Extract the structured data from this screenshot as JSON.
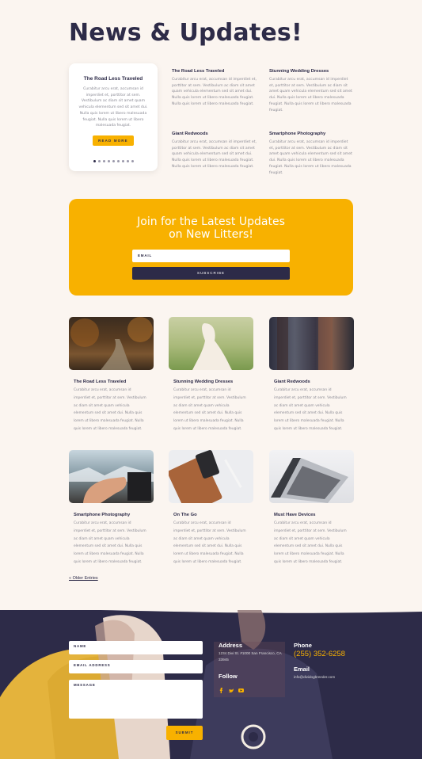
{
  "page": {
    "title": "News & Updates!"
  },
  "slider": {
    "title": "The Road Less Traveled",
    "text": "Curabitur arcu erat, accumsan id imperdiet et, porttitor at sem. Vestibulum ac diam sit amet quam vehicula elementum sed sit amet dui. Nulla quis lorem ut libero malesuada feugiat. Nulla quis lorem ut libero malesuada feugiat.",
    "button": "READ MORE"
  },
  "posts": [
    {
      "title": "The Road Less Traveled",
      "text": "Curabitur arcu erat, accumsan id imperdiet et, porttitor at sem. Vestibulum ac diam sit amet quam vehicula elementum sed sit amet dui. Nulla quis lorem ut libero malesuada feugiat. Nulla quis lorem ut libero malesuada feugiat."
    },
    {
      "title": "Stunning Wedding Dresses",
      "text": "Curabitur arcu erat, accumsan id imperdiet et, porttitor at sem. Vestibulum ac diam sit amet quam vehicula elementum sed sit amet dui. Nulla quis lorem ut libero malesuada feugiat. Nulla quis lorem ut libero malesuada feugiat."
    },
    {
      "title": "Giant Redwoods",
      "text": "Curabitur arcu erat, accumsan id imperdiet et, porttitor at sem. Vestibulum ac diam sit amet quam vehicula elementum sed sit amet dui. Nulla quis lorem ut libero malesuada feugiat. Nulla quis lorem ut libero malesuada feugiat."
    },
    {
      "title": "Smartphone Photography",
      "text": "Curabitur arcu erat, accumsan id imperdiet et, porttitor at sem. Vestibulum ac diam sit amet quam vehicula elementum sed sit amet dui. Nulla quis lorem ut libero malesuada feugiat. Nulla quis lorem ut libero malesuada feugiat."
    }
  ],
  "cta": {
    "title_line1": "Join for the Latest Updates",
    "title_line2": "on New Litters!",
    "email_placeholder": "EMAIL",
    "subscribe": "SUBSCRIBE"
  },
  "grid": [
    {
      "title": "The Road Less Traveled",
      "text": "Curabitur arcu erat, accumsan id imperdiet et, porttitor at sem. Vestibulum ac diam sit amet quam vehicula elementum sed sit amet dui. Nulla quis lorem ut libero malesuada feugiat. Nulla quis lorem ut libero malesuada feugiat."
    },
    {
      "title": "Stunning Wedding Dresses",
      "text": "Curabitur arcu erat, accumsan id imperdiet et, porttitor at sem. Vestibulum ac diam sit amet quam vehicula elementum sed sit amet dui. Nulla quis lorem ut libero malesuada feugiat. Nulla quis lorem ut libero malesuada feugiat."
    },
    {
      "title": "Giant Redwoods",
      "text": "Curabitur arcu erat, accumsan id imperdiet et, porttitor at sem. Vestibulum ac diam sit amet quam vehicula elementum sed sit amet dui. Nulla quis lorem ut libero malesuada feugiat. Nulla quis lorem ut libero malesuada feugiat."
    },
    {
      "title": "Smartphone Photography",
      "text": "Curabitur arcu erat, accumsan id imperdiet et, porttitor at sem. Vestibulum ac diam sit amet quam vehicula elementum sed sit amet dui. Nulla quis lorem ut libero malesuada feugiat. Nulla quis lorem ut libero malesuada feugiat."
    },
    {
      "title": "On The Go",
      "text": "Curabitur arcu erat, accumsan id imperdiet et, porttitor at sem. Vestibulum ac diam sit amet quam vehicula elementum sed sit amet dui. Nulla quis lorem ut libero malesuada feugiat. Nulla quis lorem ut libero malesuada feugiat."
    },
    {
      "title": "Must Have Devices",
      "text": "Curabitur arcu erat, accumsan id imperdiet et, porttitor at sem. Vestibulum ac diam sit amet quam vehicula elementum sed sit amet dui. Nulla quis lorem ut libero malesuada feugiat. Nulla quis lorem ut libero malesuada feugiat."
    }
  ],
  "older_entries": "« Older Entries",
  "footer": {
    "form": {
      "name": "NAME",
      "email": "EMAIL ADDRESS",
      "message": "MESSAGE",
      "submit": "SUBMIT"
    },
    "address_heading": "Address",
    "address_text": "1234 Divi St. #1000 San Francisco, CA 33945",
    "follow_heading": "Follow",
    "phone_heading": "Phone",
    "phone": "(255) 352-6258",
    "email_heading": "Email",
    "email": "info@dividogbreeder.com"
  },
  "colors": {
    "accent": "#f8b100",
    "navy": "#2d2b48",
    "background": "#fbf5f0"
  },
  "icons": [
    "facebook-icon",
    "twitter-icon",
    "youtube-icon"
  ]
}
